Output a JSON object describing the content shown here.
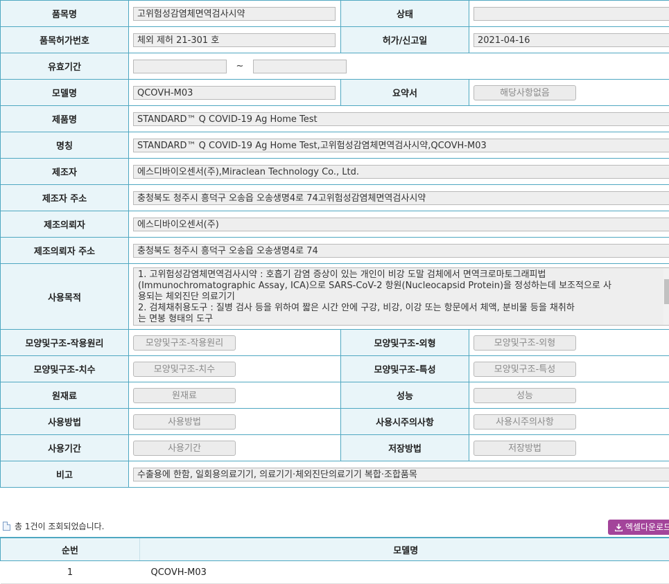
{
  "detail": {
    "product_name_label": "품목명",
    "product_name": "고위험성감염체면역검사시약",
    "status_label": "상태",
    "status": "",
    "permit_no_label": "품목허가번호",
    "permit_no": "체외 제허 21-301 호",
    "permit_date_label": "허가/신고일",
    "permit_date": "2021-04-16",
    "validity_label": "유효기간",
    "validity_from": "",
    "validity_tilde": "~",
    "validity_to": "",
    "model_label": "모델명",
    "model": "QCOVH-M03",
    "summary_label": "요약서",
    "summary_btn": "해당사항없음",
    "item_name_label": "제품명",
    "item_name": "STANDARD™ Q COVID-19 Ag Home Test",
    "title_label": "명칭",
    "title": "STANDARD™ Q COVID-19 Ag Home Test,고위험성감염체면역검사시약,QCOVH-M03",
    "maker_label": "제조자",
    "maker": "에스디바이오센서(주),Miraclean Technology Co., Ltd.",
    "maker_addr_label": "제조자 주소",
    "maker_addr": "충청북도 청주시 흥덕구 오송읍 오송생명4로 74고위험성감염체면역검사시약",
    "client_label": "제조의뢰자",
    "client": "에스디바이오센서(주)",
    "client_addr_label": "제조의뢰자 주소",
    "client_addr": "충청북도 청주시 흥덕구 오송읍 오송생명4로 74",
    "purpose_label": "사용목적",
    "purpose_lines": [
      "1. 고위험성감염체면역검사시약 : 호흡기 감염 증상이 있는 개인이 비강 도말 검체에서  면역크로마토그래피법",
      "(Immunochromatographic Assay, ICA)으로  SARS-CoV-2 항원(Nucleocapsid Protein)을 정성하는데 보조적으로 사",
      "용되는 체외진단 의료기기",
      "2. 검체채취용도구 : 질병 검사 등을 위하여 짧은 시간 안에 구강, 비강, 이강 또는 항문에서 체액, 분비물 등을 채취하",
      "는 면봉 형태의 도구"
    ],
    "principle_label": "모양및구조-작용원리",
    "principle_btn": "모양및구조-작용원리",
    "appearance_label": "모양및구조-외형",
    "appearance_btn": "모양및구조-외형",
    "dimension_label": "모양및구조-치수",
    "dimension_btn": "모양및구조-치수",
    "feature_label": "모양및구조-특성",
    "feature_btn": "모양및구조-특성",
    "material_label": "원재료",
    "material_btn": "원재료",
    "performance_label": "성능",
    "performance_btn": "성능",
    "usage_label": "사용방법",
    "usage_btn": "사용방법",
    "caution_label": "사용시주의사항",
    "caution_btn": "사용시주의사항",
    "period_label": "사용기간",
    "period_btn": "사용기간",
    "storage_label": "저장방법",
    "storage_btn": "저장방법",
    "remark_label": "비고",
    "remark": "수출용에 한함, 일회용의료기기, 의료기기·체외진단의료기기 복합·조합품목"
  },
  "result_summary": "총 1건이 조회되었습니다.",
  "excel_button": "엑셀다운로드",
  "list": {
    "headers": [
      "순번",
      "모델명"
    ],
    "rows": [
      {
        "no": "1",
        "model": "QCOVH-M03"
      }
    ]
  },
  "colors": {
    "border": "#4ea7c1",
    "header_bg": "#e9f5f9",
    "excel_button": "#a3449a"
  },
  "icons": [
    "document-icon",
    "download-icon"
  ]
}
